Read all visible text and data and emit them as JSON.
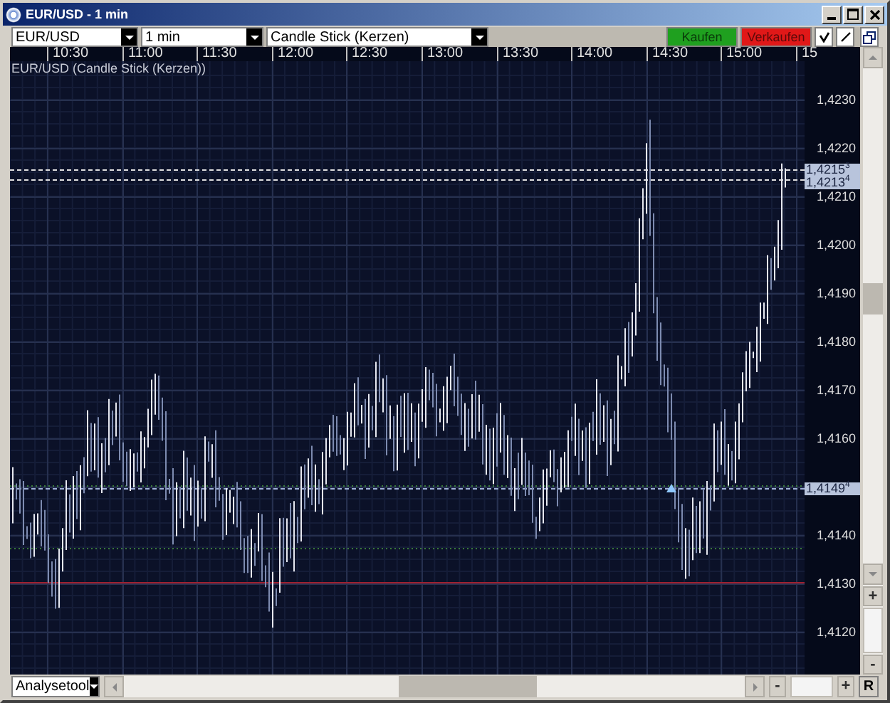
{
  "window": {
    "title": "EUR/USD - 1 min"
  },
  "toolbar": {
    "dropdowns": [
      {
        "value": "EUR/USD"
      },
      {
        "value": "1 min"
      },
      {
        "value": "Candle Stick (Kerzen)"
      }
    ],
    "buttons": [
      {
        "label": "Kaufen",
        "kind": "buy"
      },
      {
        "label": "Verkaufen",
        "kind": "sell"
      }
    ]
  },
  "chart": {
    "caption": "EUR/USD (Candle Stick (Kerzen))",
    "time_labels": [
      "10:30",
      "11:00",
      "11:30",
      "12:00",
      "12:30",
      "13:00",
      "13:30",
      "14:00",
      "14:30",
      "15:00",
      "15"
    ],
    "price_labels": [
      "1,4230",
      "1,4220",
      "1,4210",
      "1,4200",
      "1,4190",
      "1,4180",
      "1,4170",
      "1,4160",
      "1,4140",
      "1,4130",
      "1,4120"
    ],
    "price_tags": [
      {
        "label": "1,4215$^{3}$"
      },
      {
        "label": "1,4213$^{4}$"
      },
      {
        "label": "1,4149$^{4}$"
      }
    ]
  },
  "vertical_zoom": [
    "+",
    "-"
  ],
  "bottom_bar": {
    "tool_dropdown": {
      "value": "Analysetool"
    },
    "zoom_buttons": [
      "-",
      "+"
    ],
    "reset_button": "R"
  }
}
